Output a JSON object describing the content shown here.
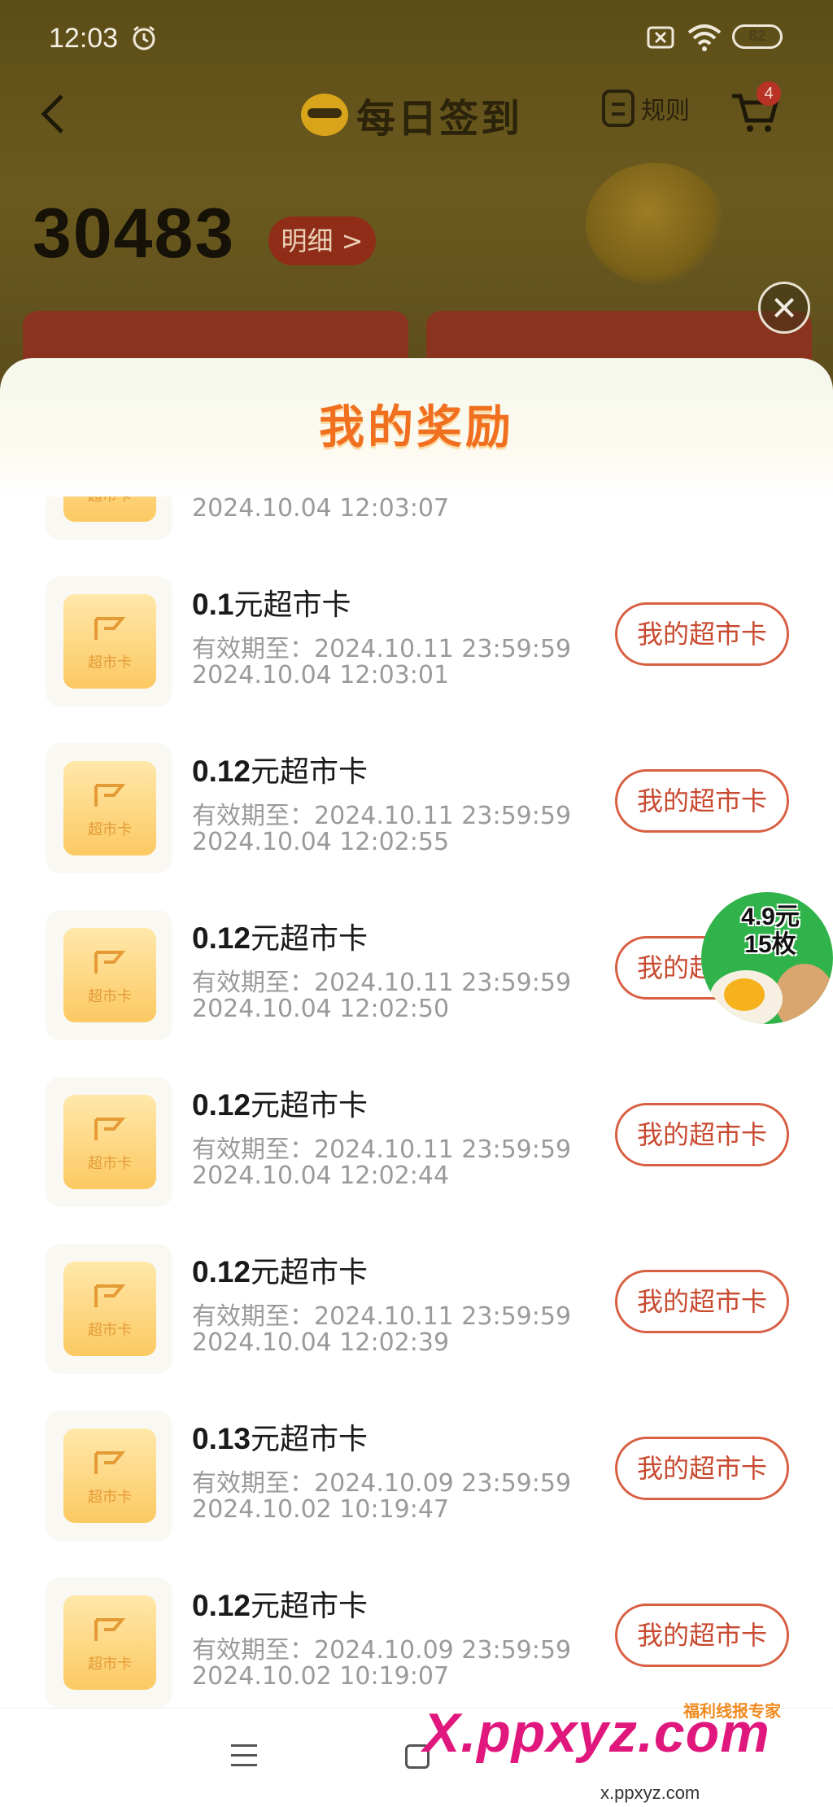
{
  "status_bar": {
    "time": "12:03",
    "battery": "82"
  },
  "header": {
    "title": "每日签到",
    "rules_label": "规则",
    "cart_badge": "4"
  },
  "points": {
    "value": "30483",
    "detail_label": "明细 >"
  },
  "sheet": {
    "title": "我的奖励"
  },
  "rewards": [
    {
      "amount": "",
      "unit": "",
      "valid": "",
      "time": "2024.10.04 12:03:07",
      "button": ""
    },
    {
      "amount": "0.1",
      "unit": "元超市卡",
      "valid": "有效期至：2024.10.11 23:59:59",
      "time": "2024.10.04 12:03:01",
      "button": "我的超市卡"
    },
    {
      "amount": "0.12",
      "unit": "元超市卡",
      "valid": "有效期至：2024.10.11 23:59:59",
      "time": "2024.10.04 12:02:55",
      "button": "我的超市卡"
    },
    {
      "amount": "0.12",
      "unit": "元超市卡",
      "valid": "有效期至：2024.10.11 23:59:59",
      "time": "2024.10.04 12:02:50",
      "button": "我的超市卡"
    },
    {
      "amount": "0.12",
      "unit": "元超市卡",
      "valid": "有效期至：2024.10.11 23:59:59",
      "time": "2024.10.04 12:02:44",
      "button": "我的超市卡"
    },
    {
      "amount": "0.12",
      "unit": "元超市卡",
      "valid": "有效期至：2024.10.11 23:59:59",
      "time": "2024.10.04 12:02:39",
      "button": "我的超市卡"
    },
    {
      "amount": "0.13",
      "unit": "元超市卡",
      "valid": "有效期至：2024.10.09 23:59:59",
      "time": "2024.10.02 10:19:47",
      "button": "我的超市卡"
    },
    {
      "amount": "0.12",
      "unit": "元超市卡",
      "valid": "有效期至：2024.10.09 23:59:59",
      "time": "2024.10.02 10:19:07",
      "button": "我的超市卡"
    }
  ],
  "card_thumb_label": "超市卡",
  "egg_badge": {
    "line1": "4.9元",
    "line2": "15枚"
  },
  "watermark": {
    "logo": "X.ppxyz.com",
    "brand": "福利线报专家",
    "url": "x.ppxyz.com"
  }
}
